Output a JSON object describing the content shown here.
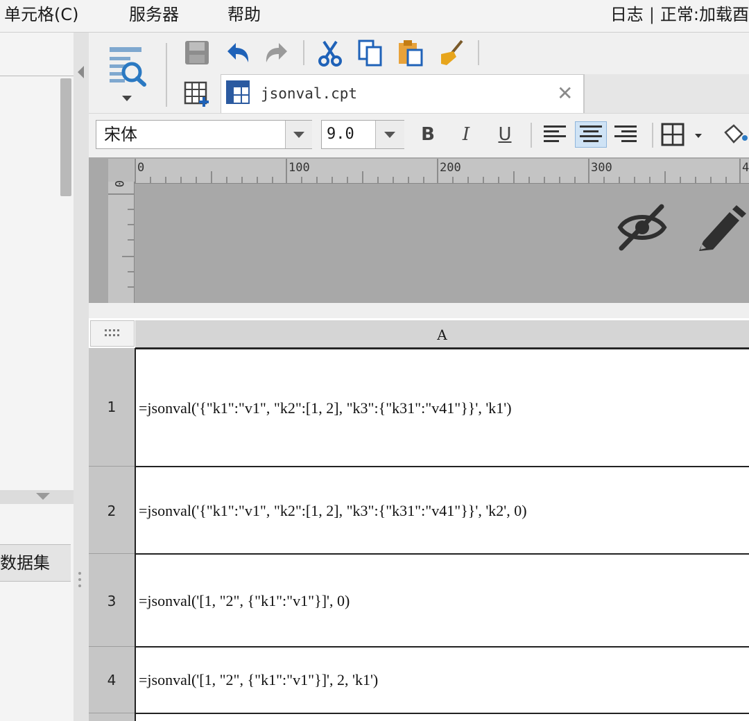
{
  "menu": {
    "items": [
      "单元格(C)",
      "服务器",
      "帮助"
    ],
    "log": "日志",
    "status": "正常:加载酉"
  },
  "left_panel": {
    "dataset_tab": "数据集"
  },
  "tabs": {
    "file_name": "jsonval.cpt",
    "close": "✕"
  },
  "format": {
    "font": "宋体",
    "size": "9.0",
    "bold": "B",
    "italic": "I",
    "underline": "U"
  },
  "ruler": {
    "h_labels": [
      "0",
      "100",
      "200",
      "300",
      "4"
    ],
    "v_label": "0"
  },
  "colors": {
    "accent": "#2b79c2",
    "cut": "#1f62b8",
    "paste": "#e8a23a",
    "clear": "#e7a51c"
  },
  "grid": {
    "column_header": "A",
    "rows": [
      {
        "num": "1",
        "formula": "=jsonval('{\"k1\":\"v1\", \"k2\":[1, 2], \"k3\":{\"k31\":\"v41\"}}', 'k1')"
      },
      {
        "num": "2",
        "formula": "=jsonval('{\"k1\":\"v1\", \"k2\":[1, 2], \"k3\":{\"k31\":\"v41\"}}', 'k2', 0)"
      },
      {
        "num": "3",
        "formula": "=jsonval('[1, \"2\", {\"k1\":\"v1\"}]', 0)"
      },
      {
        "num": "4",
        "formula": "=jsonval('[1, \"2\", {\"k1\":\"v1\"}]', 2, 'k1')"
      }
    ]
  }
}
